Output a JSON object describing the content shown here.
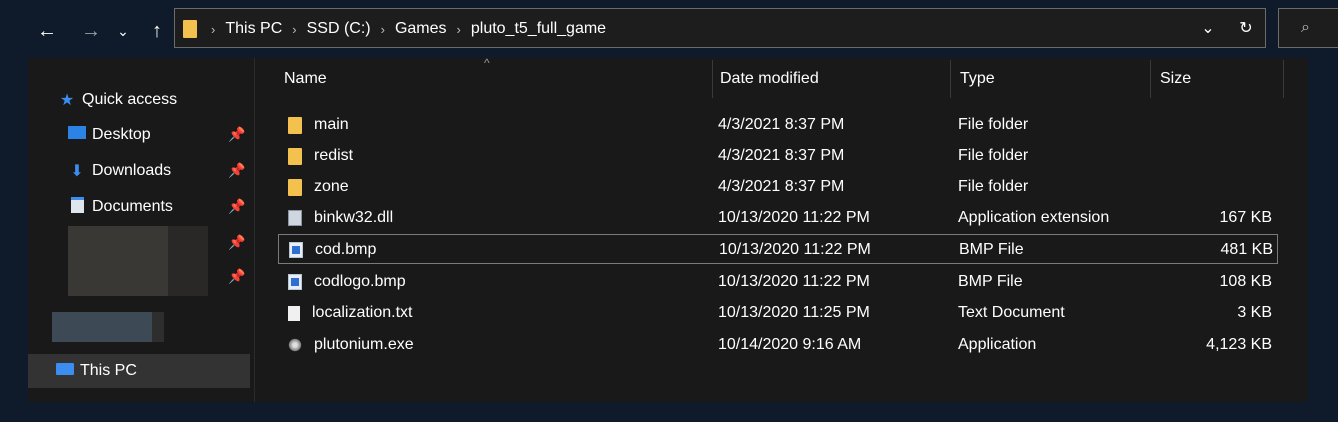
{
  "toolbar": {
    "back_icon": "back-arrow-icon",
    "forward_icon": "forward-arrow-icon",
    "recent_icon": "chevron-down-icon",
    "up_icon": "up-arrow-icon",
    "breadcrumbs": [
      "This PC",
      "SSD (C:)",
      "Games",
      "pluto_t5_full_game"
    ],
    "dropdown_icon": "chevron-down-icon",
    "refresh_icon": "refresh-icon",
    "search_icon": "search-icon"
  },
  "sidebar": {
    "quick_access": "Quick access",
    "items": [
      {
        "label": "Desktop",
        "icon": "desktop-icon",
        "pinned": true
      },
      {
        "label": "Downloads",
        "icon": "download-icon",
        "pinned": true
      },
      {
        "label": "Documents",
        "icon": "documents-icon",
        "pinned": true
      }
    ],
    "this_pc": "This PC"
  },
  "columns": {
    "name": "Name",
    "date": "Date modified",
    "type": "Type",
    "size": "Size"
  },
  "files": [
    {
      "name": "main",
      "date": "4/3/2021 8:37 PM",
      "type": "File folder",
      "size": "",
      "icon": "folder-icon"
    },
    {
      "name": "redist",
      "date": "4/3/2021 8:37 PM",
      "type": "File folder",
      "size": "",
      "icon": "folder-icon"
    },
    {
      "name": "zone",
      "date": "4/3/2021 8:37 PM",
      "type": "File folder",
      "size": "",
      "icon": "folder-icon"
    },
    {
      "name": "binkw32.dll",
      "date": "10/13/2020 11:22 PM",
      "type": "Application extension",
      "size": "167 KB",
      "icon": "dll-file-icon"
    },
    {
      "name": "cod.bmp",
      "date": "10/13/2020 11:22 PM",
      "type": "BMP File",
      "size": "481 KB",
      "icon": "bmp-file-icon"
    },
    {
      "name": "codlogo.bmp",
      "date": "10/13/2020 11:22 PM",
      "type": "BMP File",
      "size": "108 KB",
      "icon": "bmp-file-icon"
    },
    {
      "name": "localization.txt",
      "date": "10/13/2020 11:25 PM",
      "type": "Text Document",
      "size": "3 KB",
      "icon": "text-file-icon"
    },
    {
      "name": "plutonium.exe",
      "date": "10/14/2020 9:16 AM",
      "type": "Application",
      "size": "4,123 KB",
      "icon": "plutonium-app-icon"
    }
  ]
}
